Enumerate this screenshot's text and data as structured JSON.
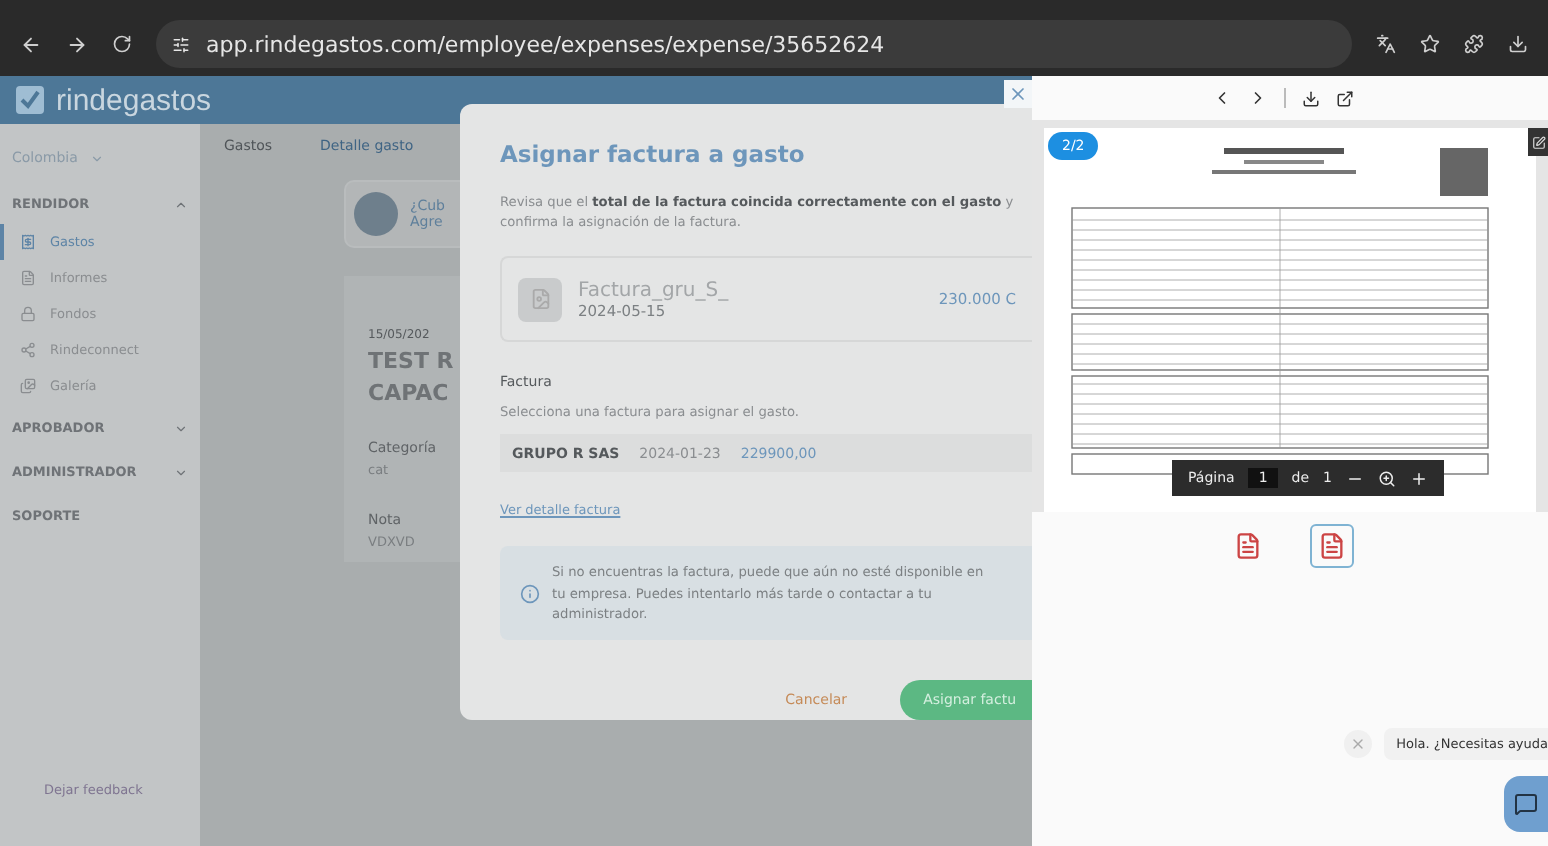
{
  "browser": {
    "url": "app.rindegastos.com/employee/expenses/expense/35652624"
  },
  "app": {
    "logo": "rindegastos",
    "country": "Colombia",
    "tabs": [
      {
        "label": "Gastos",
        "selected": false
      },
      {
        "label": "Detalle gasto",
        "selected": true
      }
    ]
  },
  "sidebar": {
    "sections": [
      {
        "title": "RENDIDOR",
        "expanded": true,
        "items": [
          {
            "label": "Gastos",
            "selected": true
          },
          {
            "label": "Informes",
            "selected": false
          },
          {
            "label": "Fondos",
            "selected": false
          },
          {
            "label": "Rindeconnect",
            "selected": false
          },
          {
            "label": "Galería",
            "selected": false
          }
        ]
      },
      {
        "title": "APROBADOR",
        "expanded": false
      },
      {
        "title": "ADMINISTRADOR",
        "expanded": false
      },
      {
        "title": "SOPORTE"
      }
    ],
    "feedback": "Dejar feedback"
  },
  "expense": {
    "banner": {
      "title": "¿Cub",
      "text": "Agre"
    },
    "date": "15/05/202",
    "title_lines": [
      "TEST R",
      "CAPAC"
    ],
    "fields": [
      {
        "label": "Categoría",
        "value": "cat"
      },
      {
        "label": "Nota",
        "value": "VDXVD"
      }
    ]
  },
  "modal": {
    "title": "Asignar factura a gasto",
    "intro": "Revisa que el **total de la factura coincida correctamente con el gasto** y confirma la asignación de la factura.",
    "file": {
      "name": "Factura_gru_S_",
      "date": "2024-05-15",
      "amount": "230.000 C"
    },
    "invoice_label": "Factura",
    "invoice_hint": "Selecciona una factura para asignar el gasto.",
    "invoice_select": {
      "vendor": "GRUPO R SAS",
      "date": "2024-01-23",
      "amount": "229900,00"
    },
    "detail_link": "Ver detalle factura",
    "info": "Si no encuentras la factura, puede que aún no esté disponible en tu empresa. Puedes intentarlo más tarde o contactar a tu administrador.",
    "buttons": [
      {
        "label": "Cancelar",
        "kind": "text"
      },
      {
        "label": "Asignar factu",
        "kind": "primary"
      }
    ]
  },
  "viewer": {
    "page_badge": "2/2",
    "pager": {
      "label": "Página",
      "page": "1",
      "of": "de",
      "total": "1"
    },
    "thumbnails": [
      {
        "selected": false
      },
      {
        "selected": true
      }
    ]
  },
  "chat": {
    "greeting": "Hola. ¿Necesitas ayuda"
  }
}
